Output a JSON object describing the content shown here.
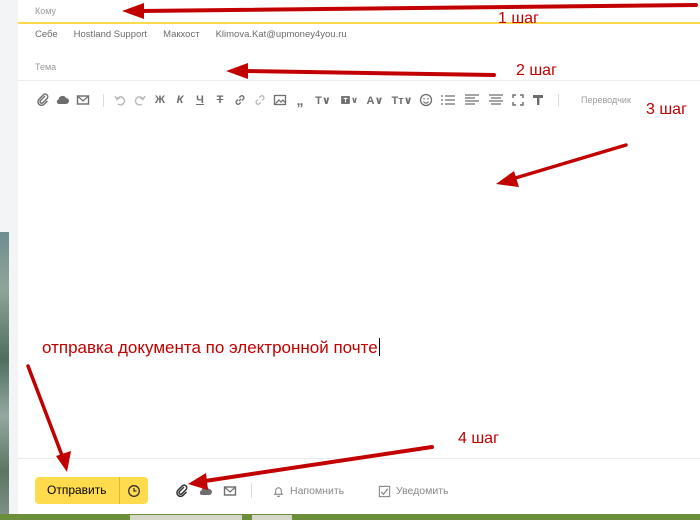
{
  "compose": {
    "to_label": "Кому",
    "suggestions": [
      "Себе",
      "Hostland Support",
      "Макхост",
      "Klimova.Kat@upmoney4you.ru"
    ],
    "subject_label": "Тема",
    "translator_label": "Переводчик",
    "body_text": "отправка документа по электронной почте"
  },
  "toolbar": {
    "icons": [
      "attach-icon",
      "cloud-icon",
      "mail-icon",
      "undo-icon",
      "redo-icon",
      "bold-icon",
      "italic-icon",
      "underline-icon",
      "strike-icon",
      "link-icon",
      "unlink-icon",
      "image-icon",
      "quote-icon",
      "font-icon",
      "font-style-icon",
      "text-color-icon",
      "text-size-icon",
      "emoji-icon",
      "list-icon",
      "align-icon",
      "align-center-icon",
      "fullscreen-icon",
      "clear-format-icon"
    ]
  },
  "annotations": {
    "step1": "1 шаг",
    "step2": "2 шаг",
    "step3": "3 шаг",
    "step4": "4 шаг",
    "color": "#c20000"
  },
  "bottom": {
    "send_label": "Отправить",
    "remind_label": "Напомнить",
    "notify_label": "Уведомить"
  },
  "colors": {
    "accent_yellow": "#ffdb4d",
    "annotation_red": "#c20000"
  }
}
